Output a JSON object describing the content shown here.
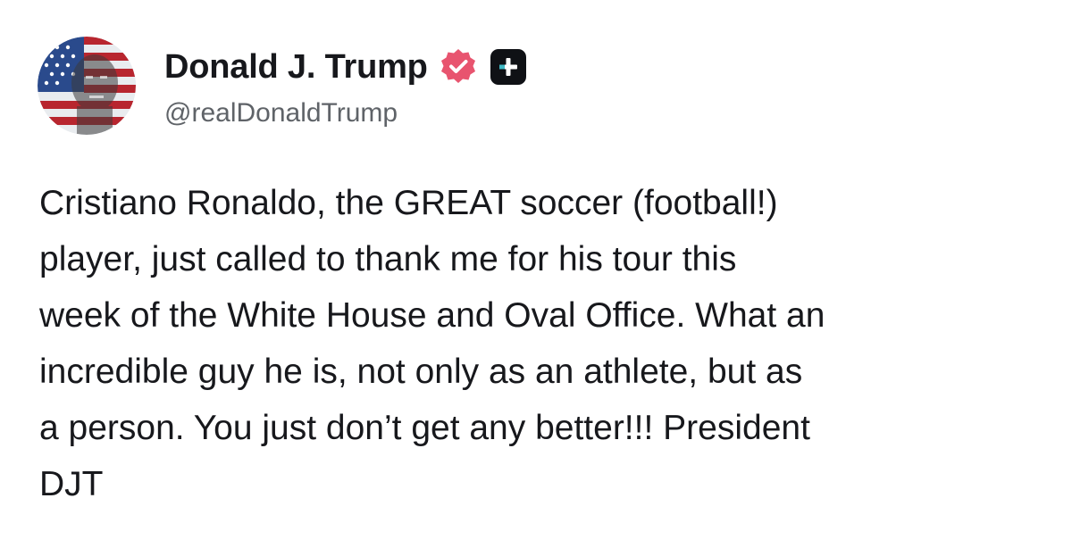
{
  "author": {
    "display_name": "Donald J. Trump",
    "handle": "@realDonaldTrump",
    "verified_icon": "verified-badge-icon",
    "plus_icon": "plus-badge-icon",
    "colors": {
      "verified_badge": "#e8546f",
      "plus_badge": "#0f1115",
      "handle_text": "#5f6368"
    }
  },
  "post": {
    "lines": [
      "Cristiano Ronaldo, the GREAT soccer (football!)",
      "player, just called to thank me for his tour this",
      "week of the White House and Oval Office. What an",
      "incredible guy he is, not only as an athlete, but as",
      "a person. You just don’t get any better!!! President",
      "DJT"
    ]
  }
}
